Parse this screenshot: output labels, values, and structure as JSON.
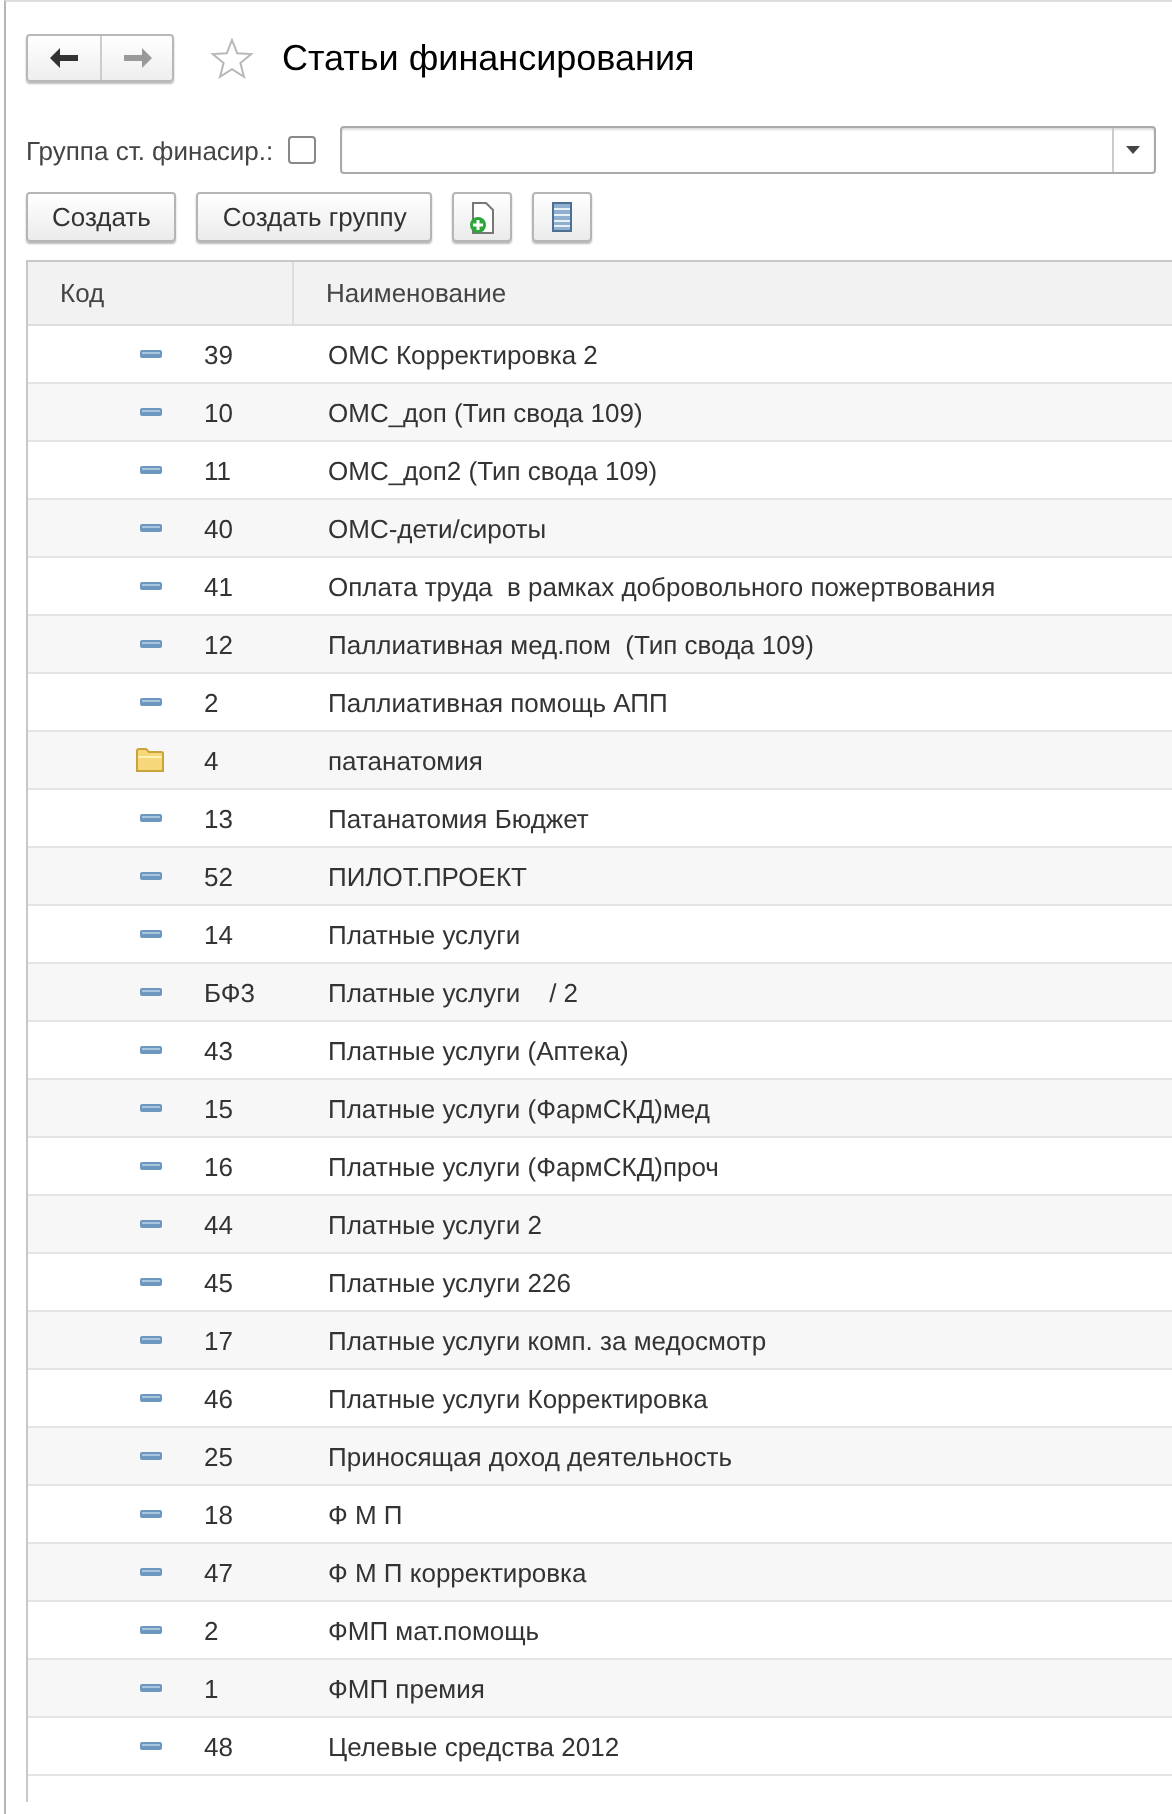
{
  "window": {
    "title": "Статьи финансирования",
    "favorite": false
  },
  "filter": {
    "label": "Группа ст. финасир.:",
    "checked": false
  },
  "buttons": [
    {
      "kind": "text",
      "label": "Создать"
    },
    {
      "kind": "text",
      "label": "Создать группу"
    },
    {
      "kind": "add-doc"
    },
    {
      "kind": "list"
    }
  ],
  "table": {
    "columns": [
      "Код",
      "Наименование"
    ],
    "rows": [
      {
        "kind": "item",
        "code": "39",
        "name": "ОМС Корректировка 2"
      },
      {
        "kind": "item",
        "code": "10",
        "name": "ОМС_доп (Тип свода 109)"
      },
      {
        "kind": "item",
        "code": "11",
        "name": "ОМС_доп2 (Тип свода 109)"
      },
      {
        "kind": "item",
        "code": "40",
        "name": "ОМС-дети/сироты"
      },
      {
        "kind": "item",
        "code": "41",
        "name": "Оплата труда  в рамках добровольного пожертвования"
      },
      {
        "kind": "item",
        "code": "12",
        "name": "Паллиативная мед.пом  (Тип свода 109)"
      },
      {
        "kind": "item",
        "code": "2",
        "name": "Паллиативная помощь АПП"
      },
      {
        "kind": "folder",
        "code": "4",
        "name": "патанатомия"
      },
      {
        "kind": "item",
        "code": "13",
        "name": "Патанатомия Бюджет"
      },
      {
        "kind": "item",
        "code": "52",
        "name": "ПИЛОТ.ПРОЕКТ"
      },
      {
        "kind": "item",
        "code": "14",
        "name": "Платные услуги"
      },
      {
        "kind": "item",
        "code": "БФ3",
        "name": "Платные услуги    / 2"
      },
      {
        "kind": "item",
        "code": "43",
        "name": "Платные услуги (Аптека)"
      },
      {
        "kind": "item",
        "code": "15",
        "name": "Платные услуги (ФармСКД)мед"
      },
      {
        "kind": "item",
        "code": "16",
        "name": "Платные услуги (ФармСКД)проч"
      },
      {
        "kind": "item",
        "code": "44",
        "name": "Платные услуги 2"
      },
      {
        "kind": "item",
        "code": "45",
        "name": "Платные услуги 226"
      },
      {
        "kind": "item",
        "code": "17",
        "name": "Платные услуги комп. за медосмотр"
      },
      {
        "kind": "item",
        "code": "46",
        "name": "Платные услуги Корректировка"
      },
      {
        "kind": "item",
        "code": "25",
        "name": "Приносящая доход деятельность"
      },
      {
        "kind": "item",
        "code": "18",
        "name": "Ф М П"
      },
      {
        "kind": "item",
        "code": "47",
        "name": "Ф М П корректировка"
      },
      {
        "kind": "item",
        "code": "2",
        "name": "ФМП мат.помощь"
      },
      {
        "kind": "item",
        "code": "1",
        "name": "ФМП премия"
      },
      {
        "kind": "item",
        "code": "48",
        "name": "Целевые средства 2012"
      }
    ]
  }
}
